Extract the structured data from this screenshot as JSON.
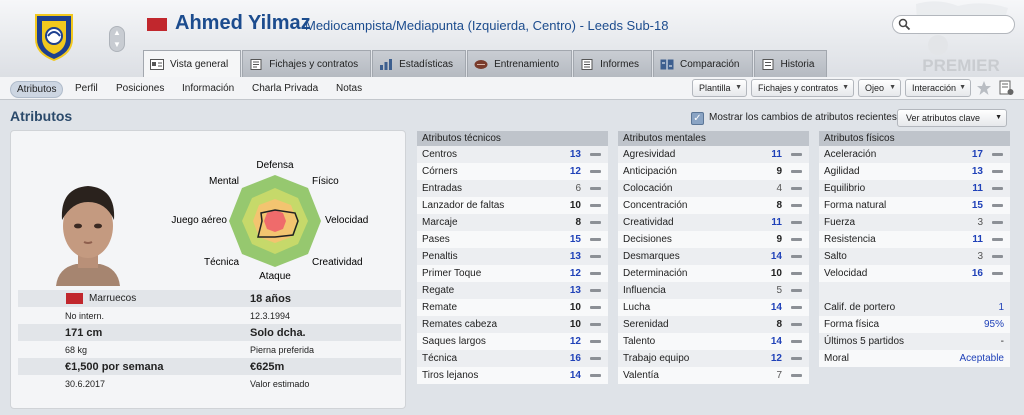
{
  "header": {
    "player_name": "Ahmed Yilmaz",
    "player_role": "Mediocampista/Mediapunta (Izquierda, Centro) - Leeds Sub-18",
    "search_placeholder": "",
    "badge_text": "PREMIER"
  },
  "tabs": [
    {
      "label": "Vista general",
      "icon": "overview-icon"
    },
    {
      "label": "Fichajes y contratos",
      "icon": "contract-icon"
    },
    {
      "label": "Estadísticas",
      "icon": "stats-icon"
    },
    {
      "label": "Entrenamiento",
      "icon": "training-ball-icon"
    },
    {
      "label": "Informes",
      "icon": "report-icon"
    },
    {
      "label": "Comparación",
      "icon": "compare-icon"
    },
    {
      "label": "Historia",
      "icon": "history-icon"
    }
  ],
  "subnav": {
    "items": [
      "Atributos",
      "Perfil",
      "Posiciones",
      "Información",
      "Charla Privada",
      "Notas"
    ],
    "dropdowns": [
      "Plantilla",
      "Fichajes y contratos",
      "Ojeo",
      "Interacción"
    ]
  },
  "section": {
    "title": "Atributos",
    "recent_changes": "Mostrar los cambios de atributos recientes",
    "recent_checked": true,
    "key_attrs": "Ver atributos clave"
  },
  "radar": {
    "labels": [
      "Defensa",
      "Físico",
      "Velocidad",
      "Creatividad",
      "Ataque",
      "Técnica",
      "Juego aéreo",
      "Mental"
    ]
  },
  "profile": {
    "nationality": "Marruecos",
    "intl": "No intern.",
    "age": "18 años",
    "dob": "12.3.1994",
    "height": "171 cm",
    "foot": "Solo dcha.",
    "weight": "68 kg",
    "foot_label": "Pierna preferida",
    "wage": "€1,500 por semana",
    "value": "€625m",
    "contract_end": "30.6.2017",
    "value_label": "Valor estimado"
  },
  "technical": {
    "title": "Atributos técnicos",
    "rows": [
      {
        "name": "Centros",
        "value": "13"
      },
      {
        "name": "Córners",
        "value": "12"
      },
      {
        "name": "Entradas",
        "value": "6"
      },
      {
        "name": "Lanzador de faltas",
        "value": "10"
      },
      {
        "name": "Marcaje",
        "value": "8"
      },
      {
        "name": "Pases",
        "value": "15"
      },
      {
        "name": "Penaltis",
        "value": "13"
      },
      {
        "name": "Primer Toque",
        "value": "12"
      },
      {
        "name": "Regate",
        "value": "13"
      },
      {
        "name": "Remate",
        "value": "10"
      },
      {
        "name": "Remates cabeza",
        "value": "10"
      },
      {
        "name": "Saques largos",
        "value": "12"
      },
      {
        "name": "Técnica",
        "value": "16"
      },
      {
        "name": "Tiros lejanos",
        "value": "14"
      }
    ]
  },
  "mental": {
    "title": "Atributos mentales",
    "rows": [
      {
        "name": "Agresividad",
        "value": "11"
      },
      {
        "name": "Anticipación",
        "value": "9"
      },
      {
        "name": "Colocación",
        "value": "4"
      },
      {
        "name": "Concentración",
        "value": "8"
      },
      {
        "name": "Creatividad",
        "value": "11"
      },
      {
        "name": "Decisiones",
        "value": "9"
      },
      {
        "name": "Desmarques",
        "value": "14"
      },
      {
        "name": "Determinación",
        "value": "10"
      },
      {
        "name": "Influencia",
        "value": "5"
      },
      {
        "name": "Lucha",
        "value": "14"
      },
      {
        "name": "Serenidad",
        "value": "8"
      },
      {
        "name": "Talento",
        "value": "14"
      },
      {
        "name": "Trabajo equipo",
        "value": "12"
      },
      {
        "name": "Valentía",
        "value": "7"
      }
    ]
  },
  "physical": {
    "title": "Atributos físicos",
    "rows": [
      {
        "name": "Aceleración",
        "value": "17"
      },
      {
        "name": "Agilidad",
        "value": "13"
      },
      {
        "name": "Equilibrio",
        "value": "11"
      },
      {
        "name": "Forma natural",
        "value": "15"
      },
      {
        "name": "Fuerza",
        "value": "3"
      },
      {
        "name": "Resistencia",
        "value": "11"
      },
      {
        "name": "Salto",
        "value": "3"
      },
      {
        "name": "Velocidad",
        "value": "16"
      }
    ],
    "extra": [
      {
        "name": "Calif. de portero",
        "value": "1"
      },
      {
        "name": "Forma física",
        "value": "95%"
      },
      {
        "name": "Últimos 5 partidos",
        "value": "-"
      },
      {
        "name": "Moral",
        "value": "Aceptable"
      }
    ]
  }
}
